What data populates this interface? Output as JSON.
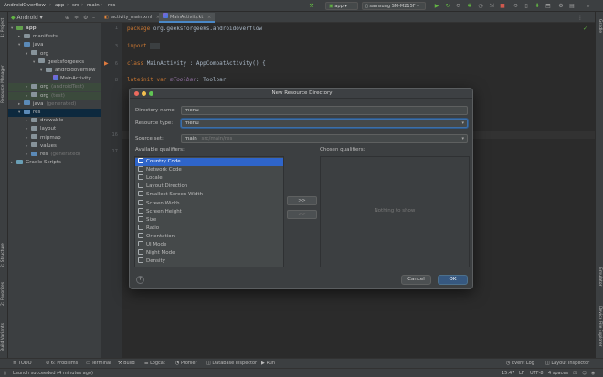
{
  "navbar": {
    "breadcrumbs": [
      "AndroidOverflow",
      "app",
      "src",
      "main",
      "res"
    ],
    "run_config": "app",
    "device": "samsung SM-M215F"
  },
  "project_panel": {
    "view_selector": "Android",
    "tree": [
      {
        "label": "app",
        "depth": 0,
        "kind": "module"
      },
      {
        "label": "manifests",
        "depth": 1,
        "kind": "folder"
      },
      {
        "label": "java",
        "depth": 1,
        "kind": "folder"
      },
      {
        "label": "org",
        "depth": 2,
        "kind": "folder"
      },
      {
        "label": "geeksforgeeks",
        "depth": 3,
        "kind": "folder"
      },
      {
        "label": "androidoverflow",
        "depth": 4,
        "kind": "folder"
      },
      {
        "label": "MainActivity",
        "depth": 5,
        "kind": "kotlin"
      },
      {
        "label": "org",
        "suffix": "(androidTest)",
        "depth": 2,
        "kind": "folder",
        "highlight": "green"
      },
      {
        "label": "org",
        "suffix": "(test)",
        "depth": 2,
        "kind": "folder",
        "highlight": "green"
      },
      {
        "label": "java",
        "suffix": "(generated)",
        "depth": 1,
        "kind": "folder"
      },
      {
        "label": "res",
        "depth": 1,
        "kind": "folder",
        "highlight": "blue"
      },
      {
        "label": "drawable",
        "depth": 2,
        "kind": "folder"
      },
      {
        "label": "layout",
        "depth": 2,
        "kind": "folder"
      },
      {
        "label": "mipmap",
        "depth": 2,
        "kind": "folder"
      },
      {
        "label": "values",
        "depth": 2,
        "kind": "folder"
      },
      {
        "label": "res",
        "suffix": "(generated)",
        "depth": 2,
        "kind": "folder"
      },
      {
        "label": "Gradle Scripts",
        "depth": 0,
        "kind": "gradle"
      }
    ]
  },
  "left_stripe": [
    "1: Project",
    "Resource Manager",
    "2: Structure",
    "2: Favorites",
    "Build Variants"
  ],
  "right_stripe": [
    "Gradle",
    "Emulator",
    "Device File Explorer"
  ],
  "editor": {
    "tabs": [
      {
        "label": "activity_main.xml",
        "active": false
      },
      {
        "label": "MainActivity.kt",
        "active": true
      }
    ],
    "lines": [
      {
        "n": "1",
        "parts": [
          [
            "kw",
            "package "
          ],
          [
            "",
            "org.geeksforgeeks.androidoverflow"
          ]
        ]
      },
      {
        "n": "2",
        "parts": []
      },
      {
        "n": "3",
        "parts": [
          [
            "kw",
            "import "
          ],
          [
            "",
            "..."
          ]
        ]
      },
      {
        "n": "4",
        "parts": []
      },
      {
        "n": "5",
        "parts": []
      },
      {
        "n": "6",
        "parts": [
          [
            "kw",
            "class "
          ],
          [
            "",
            "MainActivity : AppCompatActivity() {"
          ]
        ]
      },
      {
        "n": "7",
        "parts": []
      },
      {
        "n": "8",
        "parts": [
          [
            "kw",
            "    lateinit var "
          ],
          [
            "ital",
            "mToolbar"
          ],
          [
            "",
            ": Toolbar"
          ]
        ]
      },
      {
        "n": "16",
        "parts": []
      },
      {
        "n": "17",
        "parts": []
      }
    ]
  },
  "dialog": {
    "title": "New Resource Directory",
    "directory_name_label": "Directory name:",
    "directory_name_value": "menu",
    "resource_type_label": "Resource type:",
    "resource_type_value": "menu",
    "source_set_label": "Source set:",
    "source_set_value": "main",
    "source_set_path": "src/main/res",
    "available_label": "Available qualifiers:",
    "chosen_label": "Chosen qualifiers:",
    "qualifiers": [
      "Country Code",
      "Network Code",
      "Locale",
      "Layout Direction",
      "Smallest Screen Width",
      "Screen Width",
      "Screen Height",
      "Size",
      "Ratio",
      "Orientation",
      "UI Mode",
      "Night Mode",
      "Density"
    ],
    "selected_qualifier": "Country Code",
    "add_button": ">>",
    "remove_button": "<<",
    "nothing_to_show": "Nothing to show",
    "help": "?",
    "cancel": "Cancel",
    "ok": "OK"
  },
  "bottom_tools": [
    {
      "label": "TODO"
    },
    {
      "label": "6: Problems"
    },
    {
      "label": "Terminal"
    },
    {
      "label": "Build"
    },
    {
      "label": "Logcat"
    },
    {
      "label": "Profiler"
    },
    {
      "label": "Database Inspector"
    },
    {
      "label": "Run"
    }
  ],
  "bottom_right": {
    "event_log": "Event Log",
    "layout_inspector": "Layout Inspector"
  },
  "status": {
    "message": "Launch succeeded (4 minutes ago)",
    "position": "15:47",
    "line_sep": "LF",
    "encoding": "UTF-8",
    "indent": "4 spaces"
  },
  "colors": {
    "accent": "#2f65ca",
    "ok_button": "#365880",
    "background": "#2b2b2b"
  }
}
